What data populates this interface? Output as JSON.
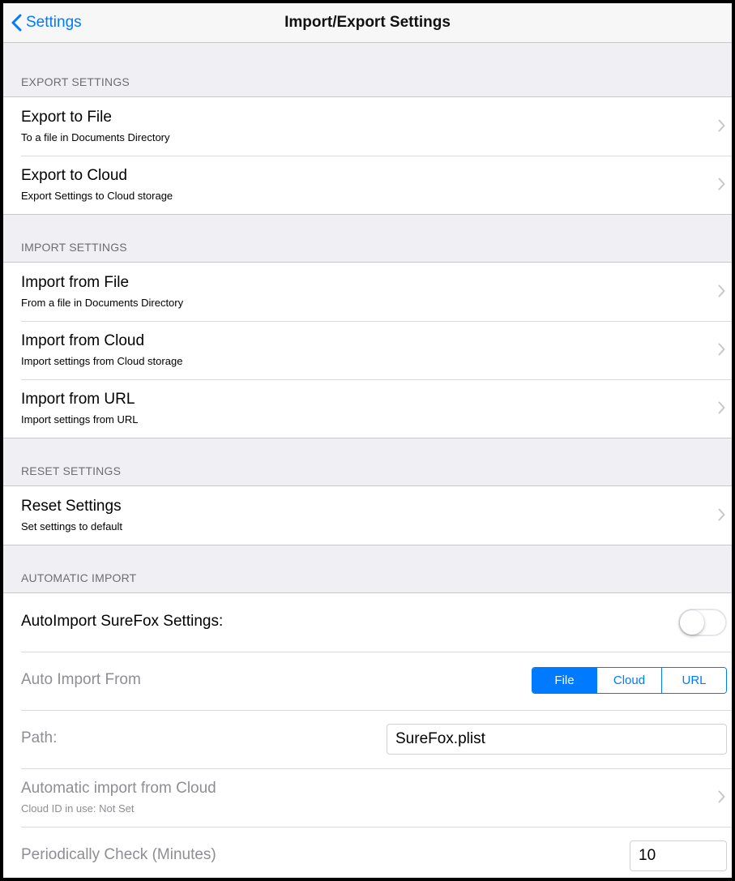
{
  "nav": {
    "back_label": "Settings",
    "title": "Import/Export Settings"
  },
  "sections": {
    "export": {
      "header": "EXPORT SETTINGS",
      "rows": [
        {
          "title": "Export to File",
          "subtitle": "To a file in Documents Directory"
        },
        {
          "title": "Export to Cloud",
          "subtitle": "Export Settings to Cloud storage"
        }
      ]
    },
    "import": {
      "header": "IMPORT SETTINGS",
      "rows": [
        {
          "title": "Import from File",
          "subtitle": "From a file in Documents Directory"
        },
        {
          "title": "Import from Cloud",
          "subtitle": "Import settings from Cloud storage"
        },
        {
          "title": "Import from URL",
          "subtitle": "Import settings from URL"
        }
      ]
    },
    "reset": {
      "header": "RESET SETTINGS",
      "rows": [
        {
          "title": "Reset Settings",
          "subtitle": "Set settings to default"
        }
      ]
    },
    "auto": {
      "header": "AUTOMATIC IMPORT",
      "autoimport_label": "AutoImport SureFox Settings:",
      "autoimport_enabled": false,
      "source_label": "Auto Import From",
      "source_options": [
        "File",
        "Cloud",
        "URL"
      ],
      "source_selected": "File",
      "path_label": "Path:",
      "path_value": "SureFox.plist",
      "cloud_title": "Automatic import from Cloud",
      "cloud_subtitle": "Cloud ID in use: Not Set",
      "period_label": "Periodically Check (Minutes)",
      "period_value": "10"
    }
  },
  "icons": {
    "back": "chevron-left-icon",
    "disclosure": "chevron-right-icon"
  },
  "colors": {
    "accent": "#007aff",
    "background": "#efeff4",
    "disabled_text": "#8e8e93"
  }
}
